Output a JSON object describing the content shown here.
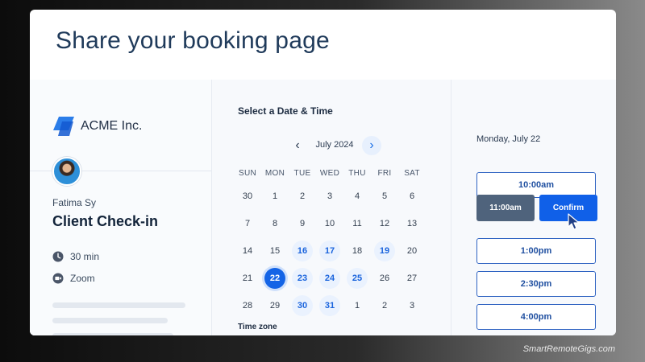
{
  "page": {
    "title": "Share your booking page"
  },
  "host": {
    "company": "ACME Inc.",
    "name": "Fatima Sy",
    "event": "Client Check-in",
    "duration": "30 min",
    "location": "Zoom"
  },
  "calendar": {
    "section_title": "Select a Date & Time",
    "month": "July 2024",
    "weekdays": [
      "SUN",
      "MON",
      "TUE",
      "WED",
      "THU",
      "FRI",
      "SAT"
    ],
    "days": [
      "30",
      "1",
      "2",
      "3",
      "4",
      "5",
      "6",
      "7",
      "8",
      "9",
      "10",
      "11",
      "12",
      "13",
      "14",
      "15",
      "16",
      "17",
      "18",
      "19",
      "20",
      "21",
      "22",
      "23",
      "24",
      "25",
      "26",
      "27",
      "28",
      "29",
      "30",
      "31",
      "1",
      "2",
      "3"
    ],
    "available_days": [
      "16",
      "17",
      "19",
      "23",
      "24",
      "25",
      "30",
      "31"
    ],
    "selected_day": "22",
    "timezone_label": "Time zone"
  },
  "times": {
    "date_label": "Monday, July 22",
    "selected_time": "11:00am",
    "confirm_label": "Confirm",
    "slots": [
      "10:00am",
      "1:00pm",
      "2:30pm",
      "4:00pm"
    ]
  },
  "watermark": "SmartRemoteGigs.com",
  "colors": {
    "accent": "#1464e6",
    "title": "#1f3a5a",
    "selected_slot": "#4f637c",
    "slot_border": "#2f63c2"
  },
  "icons": {
    "logo": "acme-logo-icon",
    "duration": "clock-icon",
    "location": "video-camera-icon",
    "prev": "chevron-left-icon",
    "next": "chevron-right-icon",
    "pointer": "mouse-cursor-icon"
  }
}
